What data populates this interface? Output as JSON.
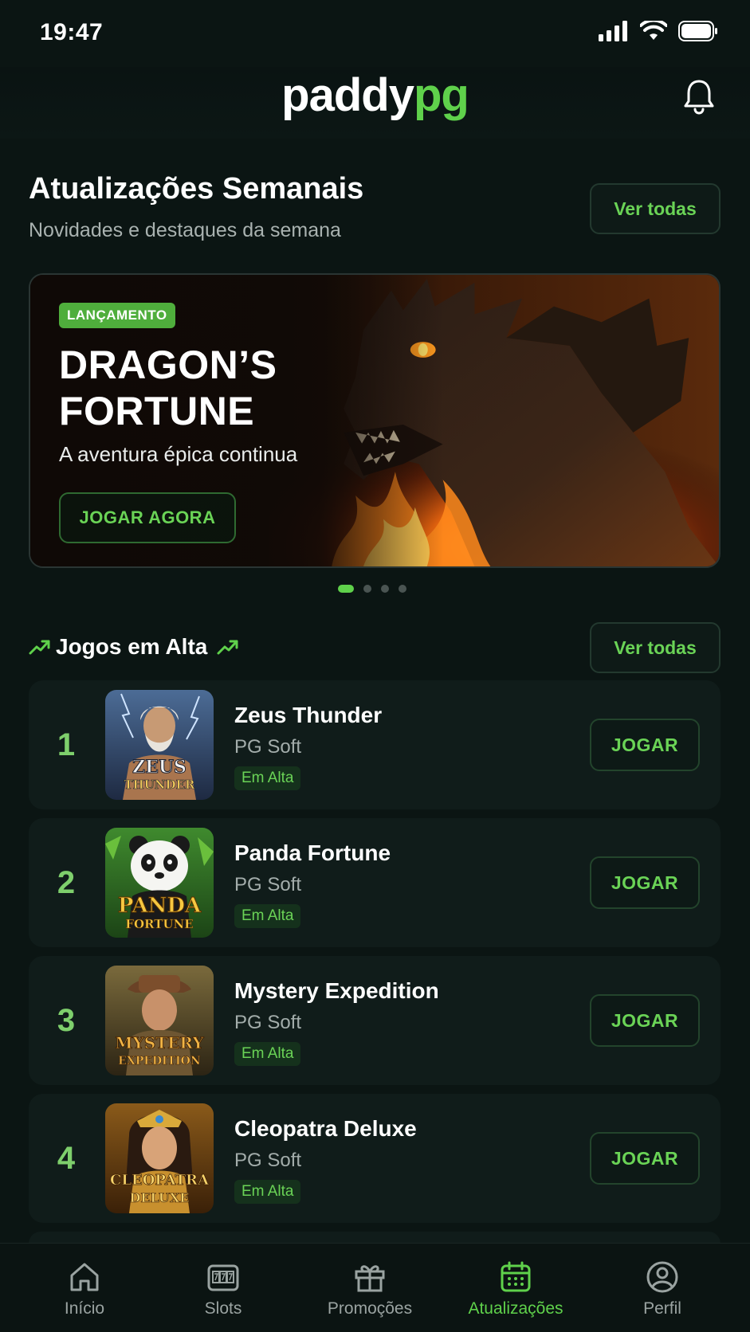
{
  "status_bar": {
    "time": "19:47"
  },
  "header": {
    "logo_part1": "paddy",
    "logo_part2": "pg"
  },
  "weekly": {
    "title": "Atualizações Semanais",
    "subtitle": "Novidades e destaques da semana",
    "view_all": "Ver todas"
  },
  "banner": {
    "badge": "LANÇAMENTO",
    "title": "DRAGON’S FORTUNE",
    "subtitle": "A aventura épica continua",
    "cta": "JOGAR AGORA",
    "slides_total": 4,
    "active_slide": 1
  },
  "trending": {
    "title": "Jogos em Alta",
    "view_all": "Ver todas",
    "games": [
      {
        "rank": "1",
        "name": "Zeus Thunder",
        "provider": "PG Soft",
        "badge": "Em Alta",
        "cta": "JOGAR",
        "thumb_line1": "ZEUS",
        "thumb_line2": "THUNDER"
      },
      {
        "rank": "2",
        "name": "Panda Fortune",
        "provider": "PG Soft",
        "badge": "Em Alta",
        "cta": "JOGAR",
        "thumb_line1": "PANDA",
        "thumb_line2": "FORTUNE"
      },
      {
        "rank": "3",
        "name": "Mystery Expedition",
        "provider": "PG Soft",
        "badge": "Em Alta",
        "cta": "JOGAR",
        "thumb_line1": "MYSTERY",
        "thumb_line2": "EXPEDITION"
      },
      {
        "rank": "4",
        "name": "Cleopatra Deluxe",
        "provider": "PG Soft",
        "badge": "Em Alta",
        "cta": "JOGAR",
        "thumb_line1": "CLEOPATRA",
        "thumb_line2": "DELUXE"
      }
    ]
  },
  "nav": {
    "items": [
      {
        "label": "Início",
        "icon": "home-icon"
      },
      {
        "label": "Slots",
        "icon": "slot-machine-icon"
      },
      {
        "label": "Promoções",
        "icon": "gift-icon"
      },
      {
        "label": "Atualizações",
        "icon": "calendar-icon",
        "active": true
      },
      {
        "label": "Perfil",
        "icon": "user-icon"
      }
    ]
  },
  "colors": {
    "accent": "#5fd14b",
    "background": "#0b1513",
    "card": "#101c1a"
  }
}
